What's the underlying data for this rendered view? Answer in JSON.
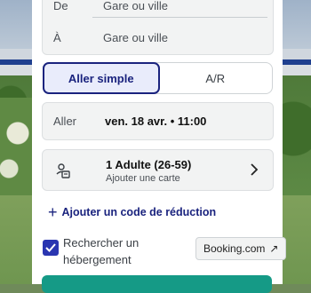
{
  "od": {
    "from_label": "De",
    "from_placeholder": "Gare ou ville",
    "to_label": "À",
    "to_placeholder": "Gare ou ville"
  },
  "trip_type": {
    "one_way": "Aller simple",
    "round_trip": "A/R",
    "selected": "one_way"
  },
  "outbound": {
    "label": "Aller",
    "value": "ven. 18 avr. • 11:00"
  },
  "passengers": {
    "title": "1 Adulte (26-59)",
    "subtitle": "Ajouter une carte",
    "icon": "passenger-icon"
  },
  "promo": {
    "plus": "+",
    "label": "Ajouter un code de réduction"
  },
  "accommodation": {
    "checked": true,
    "label": "Rechercher un hébergement",
    "partner": "Booking.com",
    "partner_icon": "external-link-icon"
  },
  "colors": {
    "accent": "#1a237e",
    "checkbox": "#2a36b1",
    "cta": "#159a86"
  }
}
